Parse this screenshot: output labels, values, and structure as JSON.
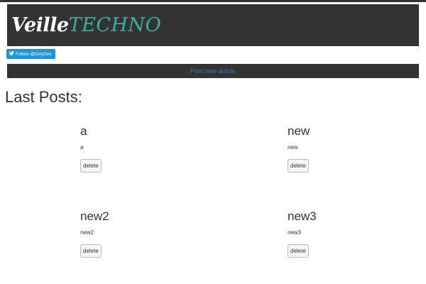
{
  "header": {
    "logo_part1": "Veille",
    "logo_part2": "TECHNO"
  },
  "twitter": {
    "icon": "twitter-bird-icon",
    "label": "Follow @GriyDev"
  },
  "nav": {
    "post_new_label": "Post new article"
  },
  "main": {
    "section_title": "Last Posts:",
    "posts": [
      {
        "title": "a",
        "body": "a",
        "delete_label": "delete"
      },
      {
        "title": "new",
        "body": "new",
        "delete_label": "delete"
      },
      {
        "title": "new2",
        "body": "new2",
        "delete_label": "delete"
      },
      {
        "title": "new3",
        "body": "new3",
        "delete_label": "delete"
      }
    ]
  },
  "colors": {
    "banner_bg": "#333333",
    "logo_accent": "#3bb0a0",
    "twitter_blue": "#1b95e0",
    "link_blue": "#337ab7"
  }
}
